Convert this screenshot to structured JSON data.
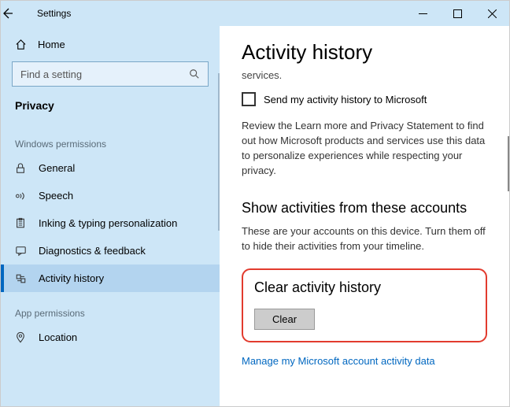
{
  "window": {
    "title": "Settings",
    "min": "—",
    "max": "▢",
    "close": "✕"
  },
  "sidebar": {
    "home_label": "Home",
    "search_placeholder": "Find a setting",
    "current_category": "Privacy",
    "group1_label": "Windows permissions",
    "group2_label": "App permissions",
    "items": [
      {
        "label": "General"
      },
      {
        "label": "Speech"
      },
      {
        "label": "Inking & typing personalization"
      },
      {
        "label": "Diagnostics & feedback"
      },
      {
        "label": "Activity history"
      }
    ],
    "app_items": [
      {
        "label": "Location"
      }
    ]
  },
  "main": {
    "title": "Activity history",
    "truncated_top": "services.",
    "checkbox_label": "Send my activity history to Microsoft",
    "review_para": "Review the Learn more and Privacy Statement to find out how Microsoft products and services use this data to personalize experiences while respecting your privacy.",
    "accounts_heading": "Show activities from these accounts",
    "accounts_para": "These are your accounts on this device. Turn them off to hide their activities from your timeline.",
    "clear_heading": "Clear activity history",
    "clear_button": "Clear",
    "manage_link": "Manage my Microsoft account activity data"
  }
}
